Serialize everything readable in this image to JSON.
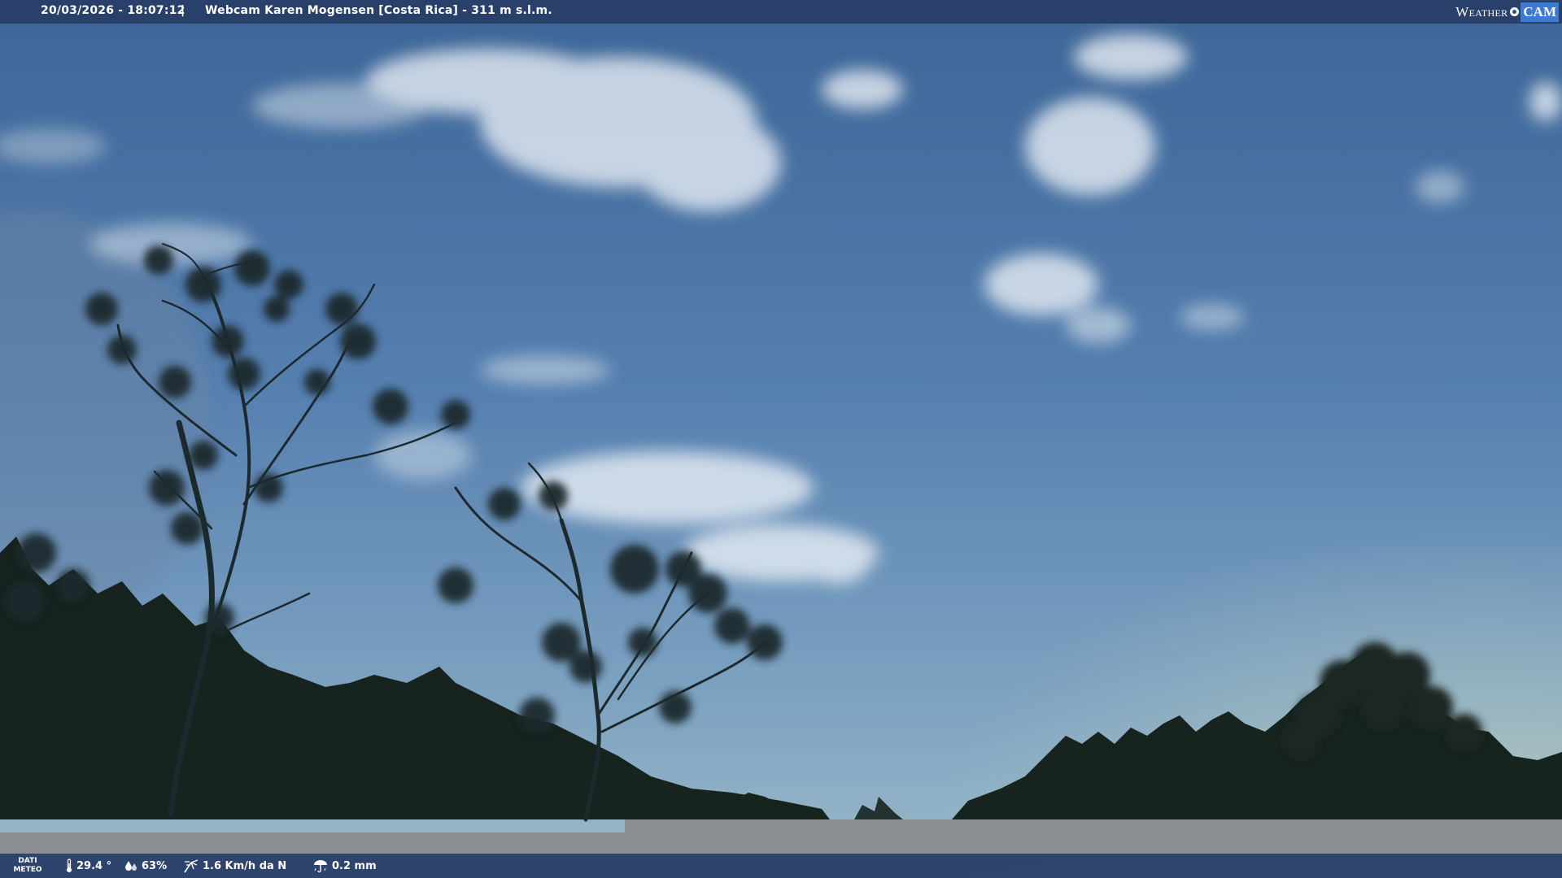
{
  "header": {
    "timestamp": "20/03/2026 - 18:07:12",
    "separator": "|",
    "title": "Webcam Karen Mogensen [Costa Rica] - 311 m s.l.m.",
    "logo_word1": "Weather",
    "logo_word2": "CAM"
  },
  "footer": {
    "dati_line1": "DATI",
    "dati_line2": "METEO",
    "temperature": "29.4 °",
    "humidity": "63%",
    "wind": "1.6 Km/h da N",
    "rain": "0.2 mm"
  },
  "icons": {
    "temperature": "thermometer-icon",
    "humidity": "humidity-drops-icon",
    "wind": "wind-icon",
    "rain": "rain-icon"
  },
  "colors": {
    "sky_top": "#3e6699",
    "sky_bottom": "#8db2c9",
    "bar": "#2a4068",
    "foliage": "#16231f"
  }
}
